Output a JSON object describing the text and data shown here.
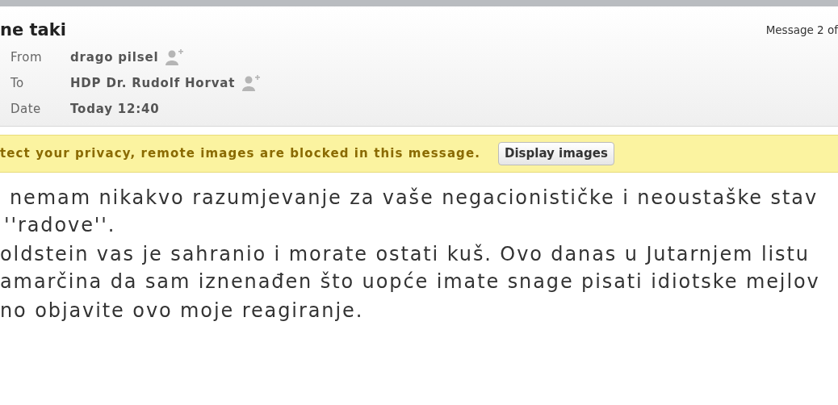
{
  "message": {
    "subject": "ne taki",
    "position": "Message 2 of",
    "fields": [
      {
        "label": "From",
        "value": "drago pilsel",
        "add_contact": true
      },
      {
        "label": "To",
        "value": "HDP Dr. Rudolf Horvat",
        "add_contact": true
      },
      {
        "label": "Date",
        "value": "Today 12:40",
        "add_contact": false
      }
    ]
  },
  "notice": {
    "text": "tect your privacy, remote images are blocked in this message.",
    "button": "Display images"
  },
  "body": [
    [
      "nemam nikakvo razumjevanje za vaše negacionističke i neoustaške stav",
      "''radove''."
    ],
    [
      "oldstein vas je sahranio i morate ostati kuš. Ovo danas u Jutarnjem listu",
      "amarčina da sam iznenađen što uopće imate snage pisati idiotske mejlov"
    ],
    [
      "no objavite ovo moje reagiranje."
    ]
  ]
}
